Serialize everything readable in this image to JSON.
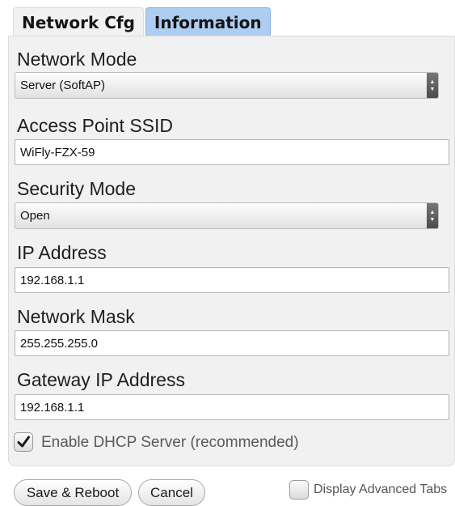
{
  "tabs": [
    {
      "label": "Network Cfg",
      "active": true
    },
    {
      "label": "Information",
      "active": false
    }
  ],
  "form": {
    "network_mode": {
      "label": "Network Mode",
      "selected": "Server (SoftAP)"
    },
    "ssid": {
      "label": "Access Point SSID",
      "value": "WiFly-FZX-59"
    },
    "security_mode": {
      "label": "Security Mode",
      "selected": "Open"
    },
    "ip_address": {
      "label": "IP Address",
      "value": "192.168.1.1"
    },
    "network_mask": {
      "label": "Network Mask",
      "value": "255.255.255.0"
    },
    "gateway": {
      "label": "Gateway IP Address",
      "value": "192.168.1.1"
    },
    "dhcp": {
      "label": "Enable DHCP Server (recommended)",
      "checked": true
    }
  },
  "footer": {
    "save_label": "Save & Reboot",
    "cancel_label": "Cancel",
    "advanced_tabs": {
      "label": "Display Advanced Tabs",
      "checked": false
    }
  },
  "colors": {
    "active_tab_bg": "#f1f1f1",
    "inactive_tab_bg": "#aecdf2",
    "panel_bg": "#f1f1f1"
  },
  "icons": {
    "select_arrow": "updown-arrow-icon",
    "checkmark": "checkmark-icon"
  }
}
